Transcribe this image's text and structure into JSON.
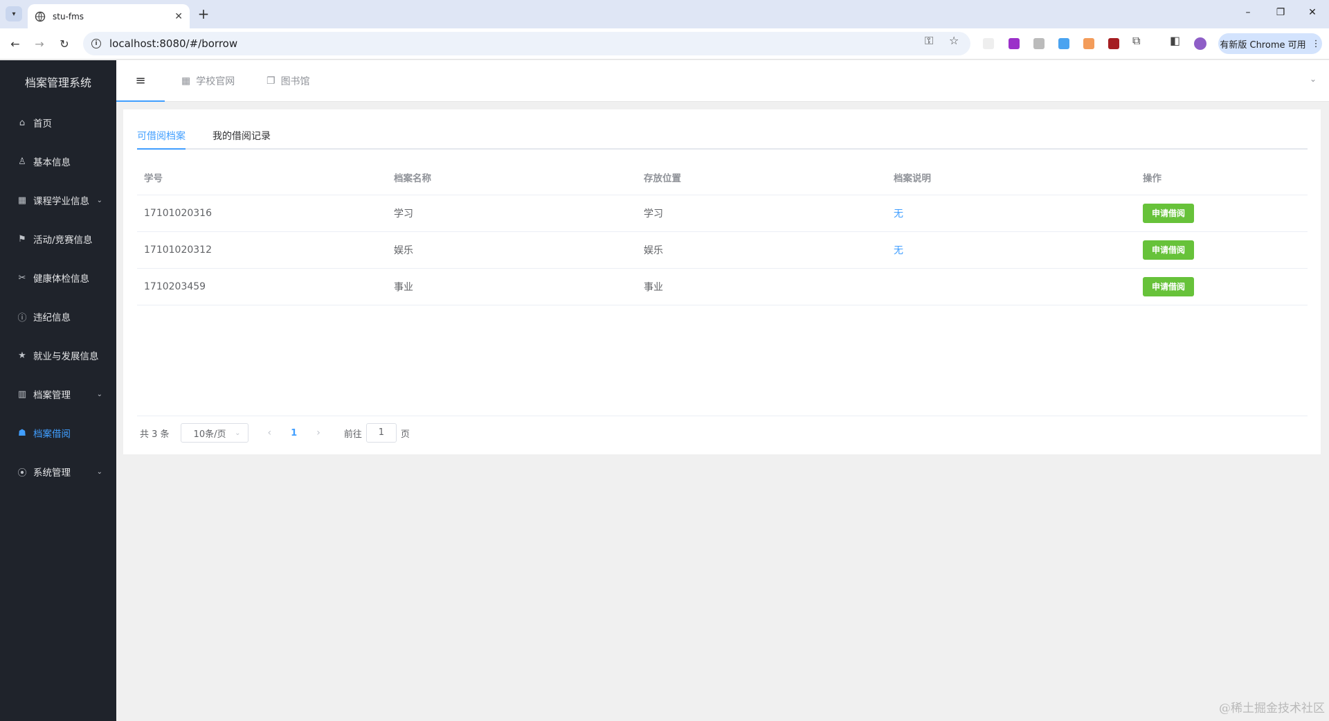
{
  "browser": {
    "tab_title": "stu-fms",
    "tab_close": "✕",
    "new_tab": "+",
    "url": "localhost:8080/#/borrow",
    "update_chip": "有新版 Chrome 可用",
    "menu_dots": "⋮"
  },
  "sidebar": {
    "brand": "档案管理系统",
    "items": [
      {
        "label": "首页",
        "icon": "home-icon",
        "glyph": "⌂"
      },
      {
        "label": "基本信息",
        "icon": "user-icon",
        "glyph": "♙"
      },
      {
        "label": "课程学业信息",
        "icon": "grid-icon",
        "glyph": "▦"
      },
      {
        "label": "活动/竞赛信息",
        "icon": "flag-icon",
        "glyph": "⚑"
      },
      {
        "label": "健康体检信息",
        "icon": "scissors-icon",
        "glyph": "✂"
      },
      {
        "label": "违纪信息",
        "icon": "info-circle-icon",
        "glyph": "ⓘ"
      },
      {
        "label": "就业与发展信息",
        "icon": "star-icon",
        "glyph": "★"
      },
      {
        "label": "档案管理",
        "icon": "stats-icon",
        "glyph": "▥"
      },
      {
        "label": "档案借阅",
        "icon": "thumb-icon",
        "glyph": "☗"
      },
      {
        "label": "系统管理",
        "icon": "location-icon",
        "glyph": "⦿"
      }
    ],
    "active_index": 8
  },
  "topbar": {
    "links": [
      {
        "label": "学校官网",
        "icon": "building-icon"
      },
      {
        "label": "图书馆",
        "icon": "copy-icon"
      }
    ]
  },
  "content": {
    "tabs": [
      "可借阅档案",
      "我的借阅记录"
    ],
    "active_tab": 0,
    "table": {
      "headers": [
        "学号",
        "档案名称",
        "存放位置",
        "档案说明",
        "操作"
      ],
      "rows": [
        {
          "id": "17101020316",
          "name": "学习",
          "location": "学习",
          "note": "无",
          "action": "申请借阅"
        },
        {
          "id": "17101020312",
          "name": "娱乐",
          "location": "娱乐",
          "note": "无",
          "action": "申请借阅"
        },
        {
          "id": "1710203459",
          "name": "事业",
          "location": "事业",
          "note": "",
          "action": "申请借阅"
        }
      ]
    },
    "pagination": {
      "total": "共 3 条",
      "page_size": "10条/页",
      "current_page": "1",
      "goto_prefix": "前往",
      "goto_value": "1",
      "goto_suffix": "页"
    }
  },
  "watermark": "@稀土掘金技术社区"
}
